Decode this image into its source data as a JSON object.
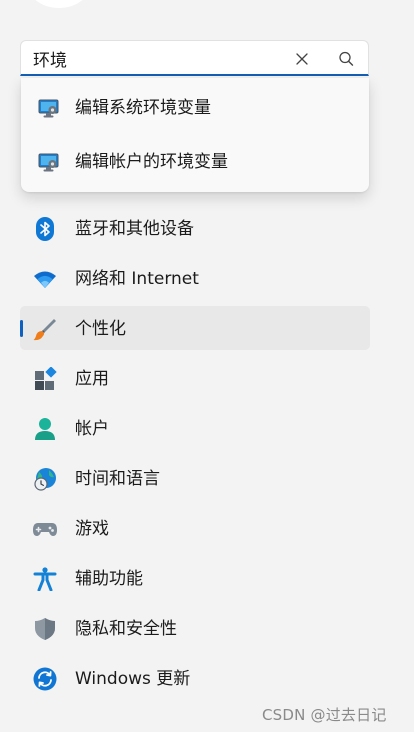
{
  "search": {
    "value": "环境",
    "clear_icon": "close-icon",
    "search_icon": "search-icon"
  },
  "suggestions": [
    {
      "label": "编辑系统环境变量",
      "icon": "monitor-settings-icon"
    },
    {
      "label": "编辑帐户的环境变量",
      "icon": "monitor-settings-icon"
    }
  ],
  "nav": {
    "selected_index": 2,
    "items": [
      {
        "label": "蓝牙和其他设备",
        "icon": "bluetooth-icon"
      },
      {
        "label": "网络和 Internet",
        "icon": "wifi-icon"
      },
      {
        "label": "个性化",
        "icon": "paintbrush-icon"
      },
      {
        "label": "应用",
        "icon": "apps-icon"
      },
      {
        "label": "帐户",
        "icon": "account-icon"
      },
      {
        "label": "时间和语言",
        "icon": "globe-clock-icon"
      },
      {
        "label": "游戏",
        "icon": "gamepad-icon"
      },
      {
        "label": "辅助功能",
        "icon": "accessibility-icon"
      },
      {
        "label": "隐私和安全性",
        "icon": "shield-icon"
      },
      {
        "label": "Windows 更新",
        "icon": "windows-update-icon"
      }
    ]
  },
  "watermark": "CSDN @过去日记",
  "colors": {
    "accent": "#1060c0",
    "background": "#f3f3f3",
    "selected_bg": "#e8e8e8"
  }
}
